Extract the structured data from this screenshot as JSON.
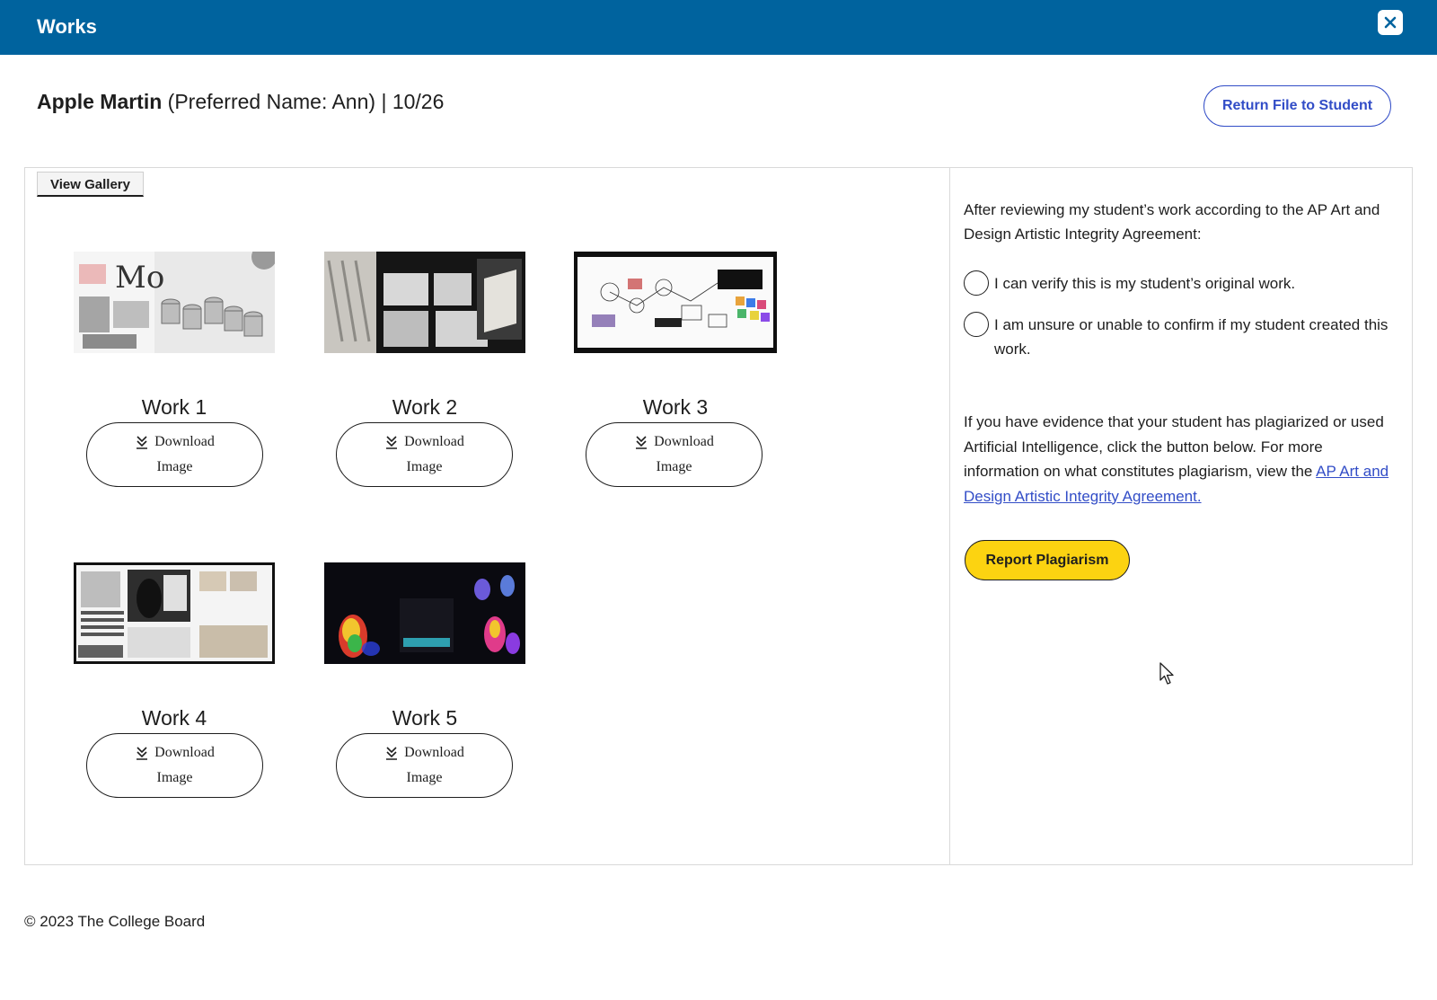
{
  "window": {
    "title": "Works"
  },
  "student": {
    "name": "Apple Martin",
    "preferred": "(Preferred Name: Ann)",
    "separator": "|",
    "progress": "10/26"
  },
  "buttons": {
    "return_file": "Return File to Student",
    "view_gallery": "View Gallery",
    "report_plagiarism": "Report Plagiarism"
  },
  "works": [
    {
      "label": "Work 1",
      "download_line1": "Download",
      "download_line2": "Image"
    },
    {
      "label": "Work 2",
      "download_line1": "Download",
      "download_line2": "Image"
    },
    {
      "label": "Work 3",
      "download_line1": "Download",
      "download_line2": "Image"
    },
    {
      "label": "Work 4",
      "download_line1": "Download",
      "download_line2": "Image"
    },
    {
      "label": "Work 5",
      "download_line1": "Download",
      "download_line2": "Image"
    }
  ],
  "review": {
    "intro": "After reviewing my student’s work according to the AP Art and Design Artistic Integrity Agreement:",
    "option_verify": "I can verify this is my student’s original work.",
    "option_unsure": "I am unsure or unable to confirm if my student created this work.",
    "evidence_text": "If you have evidence that your student has plagiarized or used Artificial Intelligence, click the button below. For more information on what constitutes plagiarism, view the",
    "agreement_link": "AP Art and Design Artistic Integrity Agreement."
  },
  "footer": {
    "copyright": "© 2023 The College Board"
  },
  "colors": {
    "header": "#00639e",
    "accent": "#324dc7",
    "report": "#fcd311"
  },
  "icons": {
    "close": "close-icon",
    "download": "download-icon",
    "cursor": "mouse-cursor-icon"
  }
}
